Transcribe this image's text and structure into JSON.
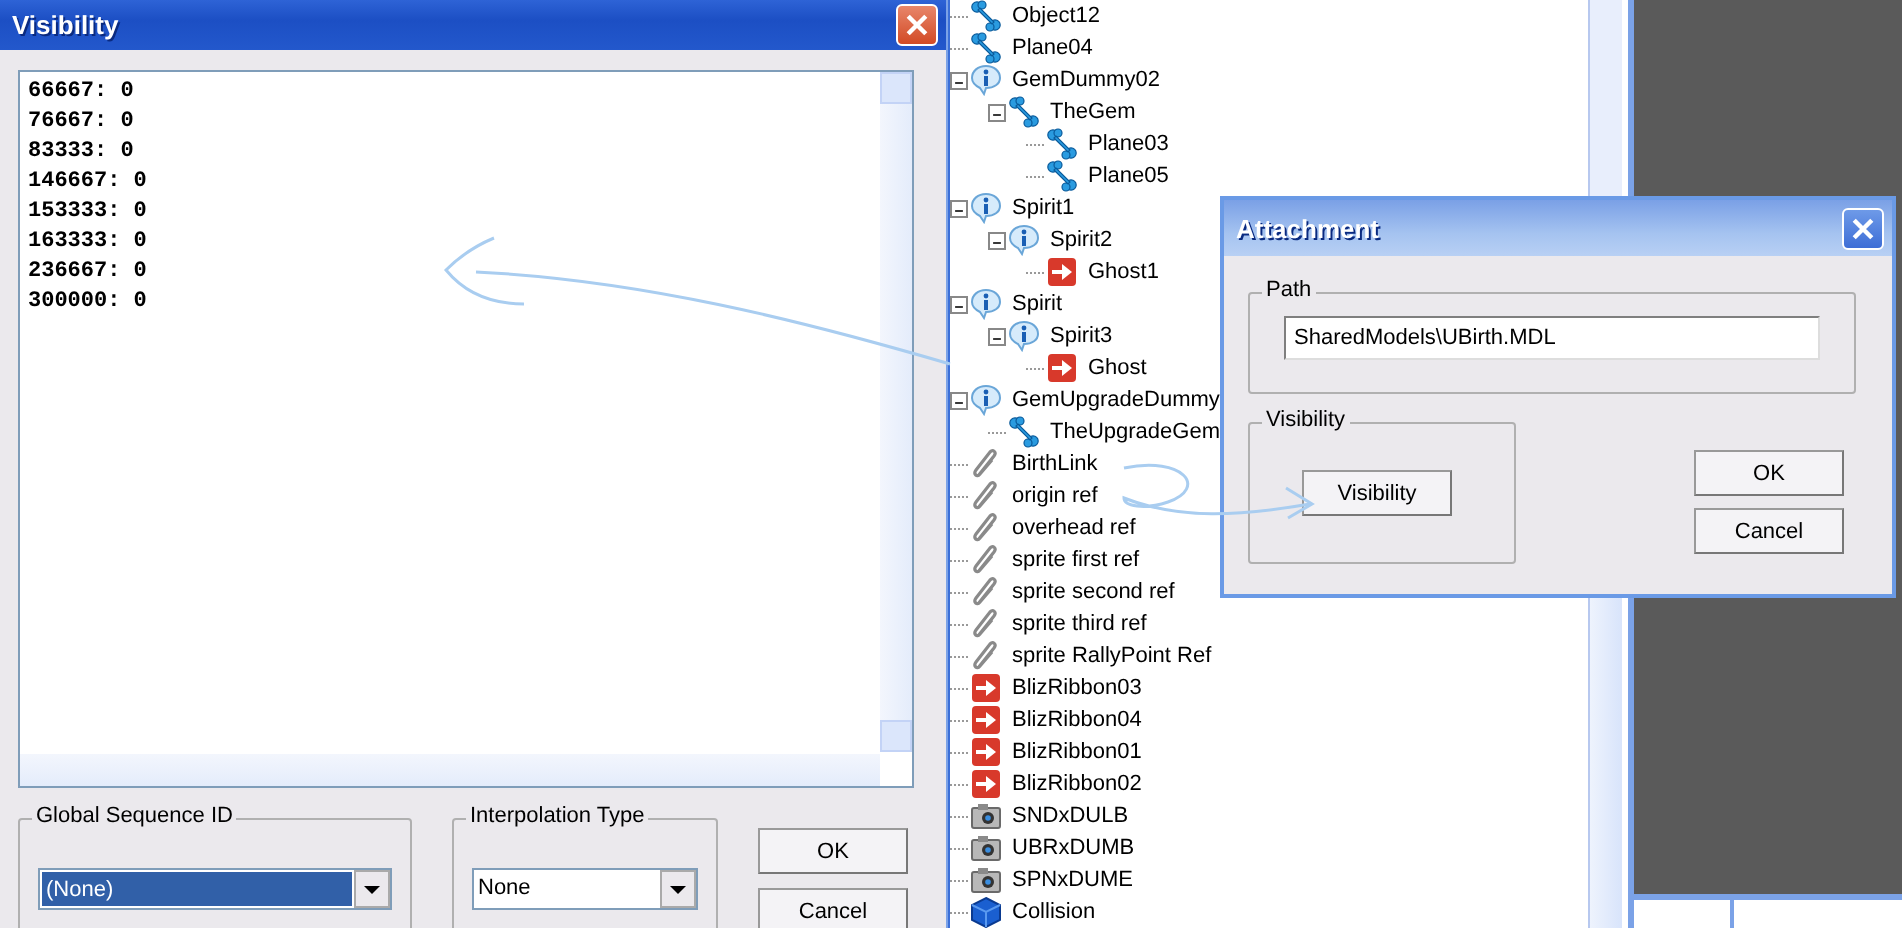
{
  "visibility_window": {
    "title": "Visibility",
    "keyframes": [
      "66667: 0",
      "76667: 0",
      "83333: 0",
      "146667: 0",
      "153333: 0",
      "163333: 0",
      "236667: 0",
      "300000: 0"
    ],
    "global_sequence": {
      "label": "Global Sequence ID",
      "value": "(None)",
      "selected": true
    },
    "interpolation": {
      "label": "Interpolation Type",
      "value": "None",
      "selected": false
    },
    "buttons": [
      "OK",
      "Cancel"
    ]
  },
  "node_tree": [
    {
      "label": "Object12",
      "kind": "bone"
    },
    {
      "label": "Plane04",
      "kind": "bone"
    },
    {
      "label": "GemDummy02",
      "kind": "helper",
      "expanded": true,
      "children": [
        {
          "label": "TheGem",
          "kind": "bone",
          "expanded": true,
          "children": [
            {
              "label": "Plane03",
              "kind": "bone"
            },
            {
              "label": "Plane05",
              "kind": "bone"
            }
          ]
        }
      ]
    },
    {
      "label": "Spirit1",
      "kind": "helper",
      "expanded": true,
      "children": [
        {
          "label": "Spirit2",
          "kind": "helper",
          "expanded": true,
          "children": [
            {
              "label": "Ghost1",
              "kind": "event"
            }
          ]
        }
      ]
    },
    {
      "label": "Spirit",
      "kind": "helper",
      "expanded": true,
      "children": [
        {
          "label": "Spirit3",
          "kind": "helper",
          "expanded": true,
          "children": [
            {
              "label": "Ghost",
              "kind": "event"
            }
          ]
        }
      ]
    },
    {
      "label": "GemUpgradeDummy",
      "kind": "helper",
      "expanded": true,
      "children": [
        {
          "label": "TheUpgradeGem",
          "kind": "bone"
        }
      ]
    },
    {
      "label": "BirthLink",
      "kind": "attachment"
    },
    {
      "label": "origin ref",
      "kind": "attachment"
    },
    {
      "label": "overhead ref",
      "kind": "attachment"
    },
    {
      "label": "sprite first ref",
      "kind": "attachment"
    },
    {
      "label": "sprite second ref",
      "kind": "attachment"
    },
    {
      "label": "sprite third ref",
      "kind": "attachment"
    },
    {
      "label": "sprite RallyPoint Ref",
      "kind": "attachment"
    },
    {
      "label": "BlizRibbon03",
      "kind": "event"
    },
    {
      "label": "BlizRibbon04",
      "kind": "event"
    },
    {
      "label": "BlizRibbon01",
      "kind": "event"
    },
    {
      "label": "BlizRibbon02",
      "kind": "event"
    },
    {
      "label": "SNDxDULB",
      "kind": "camera"
    },
    {
      "label": "UBRxDUMB",
      "kind": "camera"
    },
    {
      "label": "SPNxDUME",
      "kind": "camera"
    },
    {
      "label": "Collision",
      "kind": "collision"
    }
  ],
  "attachment_dialog": {
    "title": "Attachment",
    "path": {
      "label": "Path",
      "value": "SharedModels\\UBirth.MDL"
    },
    "visibility": {
      "label": "Visibility",
      "button": "Visibility"
    },
    "buttons": [
      "OK",
      "Cancel"
    ]
  }
}
